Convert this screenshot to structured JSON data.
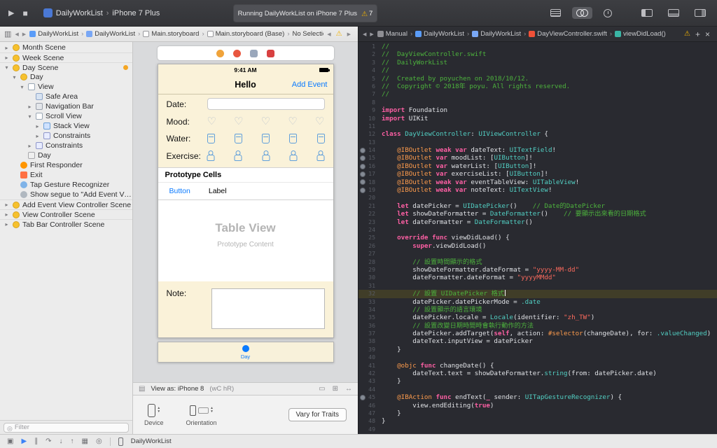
{
  "toolbar": {
    "scheme": "DailyWorkList",
    "run_destination": "iPhone 7 Plus",
    "status": "Running DailyWorkList on iPhone 7 Plus",
    "warning_count": "7"
  },
  "ib_jump_bar": {
    "items": [
      {
        "icon": "project",
        "label": "DailyWorkList"
      },
      {
        "icon": "folder",
        "label": "DailyWorkList"
      },
      {
        "icon": "storyboard",
        "label": "Main.storyboard"
      },
      {
        "icon": "storyboard",
        "label": "Main.storyboard (Base)"
      },
      {
        "label": "No Selection"
      }
    ]
  },
  "code_jump_bar": {
    "items": [
      {
        "icon": "manual",
        "label": "Manual"
      },
      {
        "icon": "project",
        "label": "DailyWorkList"
      },
      {
        "icon": "folder",
        "label": "DailyWorkList"
      },
      {
        "icon": "swift",
        "label": "DayViewController.swift"
      },
      {
        "icon": "method",
        "label": "viewDidLoad()"
      }
    ]
  },
  "outline": {
    "filter_placeholder": "Filter",
    "items": [
      {
        "label": "Month Scene",
        "depth": 0,
        "arrow": "r",
        "icon": "vc",
        "sep": true
      },
      {
        "label": "Week Scene",
        "depth": 0,
        "arrow": "r",
        "icon": "vc",
        "sep": true
      },
      {
        "label": "Day Scene",
        "depth": 0,
        "arrow": "d",
        "icon": "vc",
        "sep": true,
        "dot": true
      },
      {
        "label": "Day",
        "depth": 1,
        "arrow": "d",
        "icon": "vc"
      },
      {
        "label": "View",
        "depth": 2,
        "arrow": "d",
        "icon": "view"
      },
      {
        "label": "Safe Area",
        "depth": 3,
        "arrow": "",
        "icon": "safe"
      },
      {
        "label": "Navigation Bar",
        "depth": 3,
        "arrow": "r",
        "icon": "nav"
      },
      {
        "label": "Scroll View",
        "depth": 3,
        "arrow": "d",
        "icon": "scroll"
      },
      {
        "label": "Stack View",
        "depth": 4,
        "arrow": "r",
        "icon": "stack"
      },
      {
        "label": "Constraints",
        "depth": 4,
        "arrow": "r",
        "icon": "constraints"
      },
      {
        "label": "Constraints",
        "depth": 3,
        "arrow": "r",
        "icon": "constraints"
      },
      {
        "label": "Day",
        "depth": 2,
        "arrow": "",
        "icon": "tabitem"
      },
      {
        "label": "First Responder",
        "depth": 1,
        "arrow": "",
        "icon": "responder"
      },
      {
        "label": "Exit",
        "depth": 1,
        "arrow": "",
        "icon": "exit"
      },
      {
        "label": "Tap Gesture Recognizer",
        "depth": 1,
        "arrow": "",
        "icon": "gesture"
      },
      {
        "label": "Show segue to \"Add Event View C…\"",
        "depth": 1,
        "arrow": "",
        "icon": "segue"
      },
      {
        "label": "Add Event View Controller Scene",
        "depth": 0,
        "arrow": "r",
        "icon": "vc",
        "sep": true
      },
      {
        "label": "View Controller Scene",
        "depth": 0,
        "arrow": "r",
        "icon": "vc",
        "sep": true
      },
      {
        "label": "Tab Bar Controller Scene",
        "depth": 0,
        "arrow": "r",
        "icon": "vc",
        "sep": true
      }
    ]
  },
  "canvas": {
    "scene_dock": [
      {
        "name": "view-controller-icon",
        "color": "#f0a33a",
        "shape": "circle"
      },
      {
        "name": "first-responder-icon",
        "color": "#e8563f",
        "shape": "circle"
      },
      {
        "name": "exit-icon",
        "color": "#9aa7bb",
        "shape": "square"
      },
      {
        "name": "storyboard-entry-icon",
        "color": "#d84040",
        "shape": "square"
      }
    ],
    "status_time": "9:41 AM",
    "nav": {
      "title": "Hello",
      "right_button": "Add Event"
    },
    "form": {
      "rows": [
        {
          "label": "Date:",
          "type": "field",
          "name": "date-text-field"
        },
        {
          "label": "Mood:",
          "type": "hearts",
          "count": 5,
          "name": "mood-heart-button"
        },
        {
          "label": "Water:",
          "type": "cups",
          "count": 5,
          "name": "water-cup-button"
        },
        {
          "label": "Exercise:",
          "type": "people",
          "count": 5,
          "name": "exercise-button"
        }
      ]
    },
    "prototype": {
      "header": "Prototype Cells",
      "cell_button": "Button",
      "cell_label": "Label"
    },
    "table_placeholder": {
      "title": "Table View",
      "subtitle": "Prototype Content"
    },
    "note_label": "Note:",
    "tab_item": "Day",
    "view_as": {
      "prefix": "View as: iPhone 8",
      "traits": "(wC hR)",
      "left_icon": {
        "name": "canvas-options-icon",
        "glyph": "▤"
      },
      "right_icons": [
        {
          "name": "fit-canvas-icon",
          "glyph": "▭"
        },
        {
          "name": "zoom-controls-icon",
          "glyph": "⊞"
        },
        {
          "name": "full-width-icon",
          "glyph": "↔"
        }
      ]
    },
    "config": {
      "device_label": "Device",
      "orientation_label": "Orientation",
      "vary_button": "Vary for Traits"
    }
  },
  "code": {
    "lines": [
      {
        "n": 1,
        "t": [
          [
            "c",
            "//"
          ]
        ]
      },
      {
        "n": 2,
        "t": [
          [
            "c",
            "//  DayViewController.swift"
          ]
        ]
      },
      {
        "n": 3,
        "t": [
          [
            "c",
            "//  DailyWorkList"
          ]
        ]
      },
      {
        "n": 4,
        "t": [
          [
            "c",
            "//"
          ]
        ]
      },
      {
        "n": 5,
        "t": [
          [
            "c",
            "//  Created by poyuchen on 2018/10/12."
          ]
        ]
      },
      {
        "n": 6,
        "t": [
          [
            "c",
            "//  Copyright © 2018年 poyu. All rights reserved."
          ]
        ]
      },
      {
        "n": 7,
        "t": [
          [
            "c",
            "//"
          ]
        ]
      },
      {
        "n": 8,
        "t": []
      },
      {
        "n": 9,
        "t": [
          [
            "k",
            "import"
          ],
          [
            "p",
            " Foundation"
          ]
        ]
      },
      {
        "n": 10,
        "t": [
          [
            "k",
            "import"
          ],
          [
            "p",
            " UIKit"
          ]
        ]
      },
      {
        "n": 11,
        "t": []
      },
      {
        "n": 12,
        "t": [
          [
            "k",
            "class"
          ],
          [
            "p",
            " "
          ],
          [
            "t",
            "DayViewController"
          ],
          [
            "p",
            ": "
          ],
          [
            "t",
            "UIViewController"
          ],
          [
            "p",
            " {"
          ]
        ]
      },
      {
        "n": 13,
        "t": []
      },
      {
        "n": 14,
        "dot": true,
        "t": [
          [
            "p",
            "    "
          ],
          [
            "a",
            "@IBOutlet"
          ],
          [
            "p",
            " "
          ],
          [
            "k",
            "weak"
          ],
          [
            "p",
            " "
          ],
          [
            "k",
            "var"
          ],
          [
            "p",
            " dateText: "
          ],
          [
            "t",
            "UITextField"
          ],
          [
            "p",
            "!"
          ]
        ]
      },
      {
        "n": 15,
        "dot": true,
        "t": [
          [
            "p",
            "    "
          ],
          [
            "a",
            "@IBOutlet"
          ],
          [
            "p",
            " "
          ],
          [
            "k",
            "var"
          ],
          [
            "p",
            " moodList: ["
          ],
          [
            "t",
            "UIButton"
          ],
          [
            "p",
            "]!"
          ]
        ]
      },
      {
        "n": 16,
        "dot": true,
        "t": [
          [
            "p",
            "    "
          ],
          [
            "a",
            "@IBOutlet"
          ],
          [
            "p",
            " "
          ],
          [
            "k",
            "var"
          ],
          [
            "p",
            " waterList: ["
          ],
          [
            "t",
            "UIButton"
          ],
          [
            "p",
            "]!"
          ]
        ]
      },
      {
        "n": 17,
        "dot": true,
        "t": [
          [
            "p",
            "    "
          ],
          [
            "a",
            "@IBOutlet"
          ],
          [
            "p",
            " "
          ],
          [
            "k",
            "var"
          ],
          [
            "p",
            " exerciseList: ["
          ],
          [
            "t",
            "UIButton"
          ],
          [
            "p",
            "]!"
          ]
        ]
      },
      {
        "n": 18,
        "dot": true,
        "t": [
          [
            "p",
            "    "
          ],
          [
            "a",
            "@IBOutlet"
          ],
          [
            "p",
            " "
          ],
          [
            "k",
            "weak"
          ],
          [
            "p",
            " "
          ],
          [
            "k",
            "var"
          ],
          [
            "p",
            " eventTableView: "
          ],
          [
            "t",
            "UITableView"
          ],
          [
            "p",
            "!"
          ]
        ]
      },
      {
        "n": 19,
        "dot": true,
        "t": [
          [
            "p",
            "    "
          ],
          [
            "a",
            "@IBOutlet"
          ],
          [
            "p",
            " "
          ],
          [
            "k",
            "weak"
          ],
          [
            "p",
            " "
          ],
          [
            "k",
            "var"
          ],
          [
            "p",
            " noteText: "
          ],
          [
            "t",
            "UITextView"
          ],
          [
            "p",
            "!"
          ]
        ]
      },
      {
        "n": 20,
        "t": []
      },
      {
        "n": 21,
        "t": [
          [
            "p",
            "    "
          ],
          [
            "k",
            "let"
          ],
          [
            "p",
            " datePicker = "
          ],
          [
            "t",
            "UIDatePicker"
          ],
          [
            "p",
            "()    "
          ],
          [
            "c",
            "// Date的DatePicker"
          ]
        ]
      },
      {
        "n": 22,
        "t": [
          [
            "p",
            "    "
          ],
          [
            "k",
            "let"
          ],
          [
            "p",
            " showDateFormatter = "
          ],
          [
            "t",
            "DateFormatter"
          ],
          [
            "p",
            "()    "
          ],
          [
            "c",
            "// 要顯示出來看的日期格式"
          ]
        ]
      },
      {
        "n": 23,
        "t": [
          [
            "p",
            "    "
          ],
          [
            "k",
            "let"
          ],
          [
            "p",
            " dateFormatter = "
          ],
          [
            "t",
            "DateFormatter"
          ],
          [
            "p",
            "()"
          ]
        ]
      },
      {
        "n": 24,
        "t": []
      },
      {
        "n": 25,
        "t": [
          [
            "p",
            "    "
          ],
          [
            "k",
            "override"
          ],
          [
            "p",
            " "
          ],
          [
            "k",
            "func"
          ],
          [
            "p",
            " viewDidLoad() {"
          ]
        ]
      },
      {
        "n": 26,
        "t": [
          [
            "p",
            "        "
          ],
          [
            "k",
            "super"
          ],
          [
            "p",
            ".viewDidLoad()"
          ]
        ]
      },
      {
        "n": 27,
        "t": []
      },
      {
        "n": 28,
        "t": [
          [
            "p",
            "        "
          ],
          [
            "c",
            "// 設置時間顯示的格式"
          ]
        ]
      },
      {
        "n": 29,
        "t": [
          [
            "p",
            "        showDateFormatter.dateFormat = "
          ],
          [
            "s",
            "\"yyyy-MM-dd\""
          ]
        ]
      },
      {
        "n": 30,
        "t": [
          [
            "p",
            "        dateFormatter.dateFormat = "
          ],
          [
            "s",
            "\"yyyyMMdd\""
          ]
        ]
      },
      {
        "n": 31,
        "t": []
      },
      {
        "n": 32,
        "hl": true,
        "cursor": true,
        "t": [
          [
            "p",
            "        "
          ],
          [
            "c",
            "// 設置 UIDatePicker 格式"
          ]
        ]
      },
      {
        "n": 33,
        "t": [
          [
            "p",
            "        datePicker.datePickerMode = "
          ],
          [
            "t",
            ".date"
          ]
        ]
      },
      {
        "n": 34,
        "t": [
          [
            "p",
            "        "
          ],
          [
            "c",
            "// 設置顯示的語言環境"
          ]
        ]
      },
      {
        "n": 35,
        "t": [
          [
            "p",
            "        datePicker.locale = "
          ],
          [
            "t",
            "Locale"
          ],
          [
            "p",
            "(identifier: "
          ],
          [
            "s",
            "\"zh_TW\""
          ],
          [
            "p",
            ")"
          ]
        ]
      },
      {
        "n": 36,
        "t": [
          [
            "p",
            "        "
          ],
          [
            "c",
            "// 設置改變日期時間時會執行動作的方法"
          ]
        ]
      },
      {
        "n": 37,
        "t": [
          [
            "p",
            "        datePicker.addTarget("
          ],
          [
            "k",
            "self"
          ],
          [
            "p",
            ", action: "
          ],
          [
            "a",
            "#selector"
          ],
          [
            "p",
            "(changeDate), for: "
          ],
          [
            "t",
            ".valueChanged"
          ],
          [
            "p",
            ")"
          ]
        ]
      },
      {
        "n": 38,
        "t": [
          [
            "p",
            "        dateText.inputView = datePicker"
          ]
        ]
      },
      {
        "n": 39,
        "t": [
          [
            "p",
            "    }"
          ]
        ]
      },
      {
        "n": 40,
        "t": []
      },
      {
        "n": 41,
        "t": [
          [
            "p",
            "    "
          ],
          [
            "a",
            "@objc"
          ],
          [
            "p",
            " "
          ],
          [
            "k",
            "func"
          ],
          [
            "p",
            " changeDate() {"
          ]
        ]
      },
      {
        "n": 42,
        "t": [
          [
            "p",
            "        dateText.text = showDateFormatter."
          ],
          [
            "t",
            "string"
          ],
          [
            "p",
            "(from: datePicker.date)"
          ]
        ]
      },
      {
        "n": 43,
        "t": [
          [
            "p",
            "    }"
          ]
        ]
      },
      {
        "n": 44,
        "t": []
      },
      {
        "n": 45,
        "dot": true,
        "t": [
          [
            "p",
            "    "
          ],
          [
            "a",
            "@IBAction"
          ],
          [
            "p",
            " "
          ],
          [
            "k",
            "func"
          ],
          [
            "p",
            " endText("
          ],
          [
            "k",
            "_"
          ],
          [
            "p",
            " sender: "
          ],
          [
            "t",
            "UITapGestureRecognizer"
          ],
          [
            "p",
            ") {"
          ]
        ]
      },
      {
        "n": 46,
        "t": [
          [
            "p",
            "        view.endEditing("
          ],
          [
            "k",
            "true"
          ],
          [
            "p",
            ")"
          ]
        ]
      },
      {
        "n": 47,
        "t": [
          [
            "p",
            "    }"
          ]
        ]
      },
      {
        "n": 48,
        "t": [
          [
            "p",
            "}"
          ]
        ]
      },
      {
        "n": 49,
        "t": []
      }
    ]
  },
  "bottom_bar": {
    "app_label": "DailyWorkList",
    "icons": [
      {
        "name": "debug-area-toggle-icon",
        "glyph": "▣"
      },
      {
        "name": "breakpoints-toggle-icon",
        "glyph": "▶",
        "color": "#3b82f7"
      },
      {
        "name": "pause-icon",
        "glyph": "∥"
      },
      {
        "name": "step-over-icon",
        "glyph": "↷"
      },
      {
        "name": "step-into-icon",
        "glyph": "↓"
      },
      {
        "name": "step-out-icon",
        "glyph": "↑"
      },
      {
        "name": "view-hierarchy-icon",
        "glyph": "▦"
      },
      {
        "name": "memory-graph-icon",
        "glyph": "◎"
      }
    ]
  },
  "colors": {
    "accent_blue": "#0a7aff",
    "warning_yellow": "#f2b200",
    "editor_background": "#292a30",
    "canvas_cream": "#faf2d9"
  }
}
